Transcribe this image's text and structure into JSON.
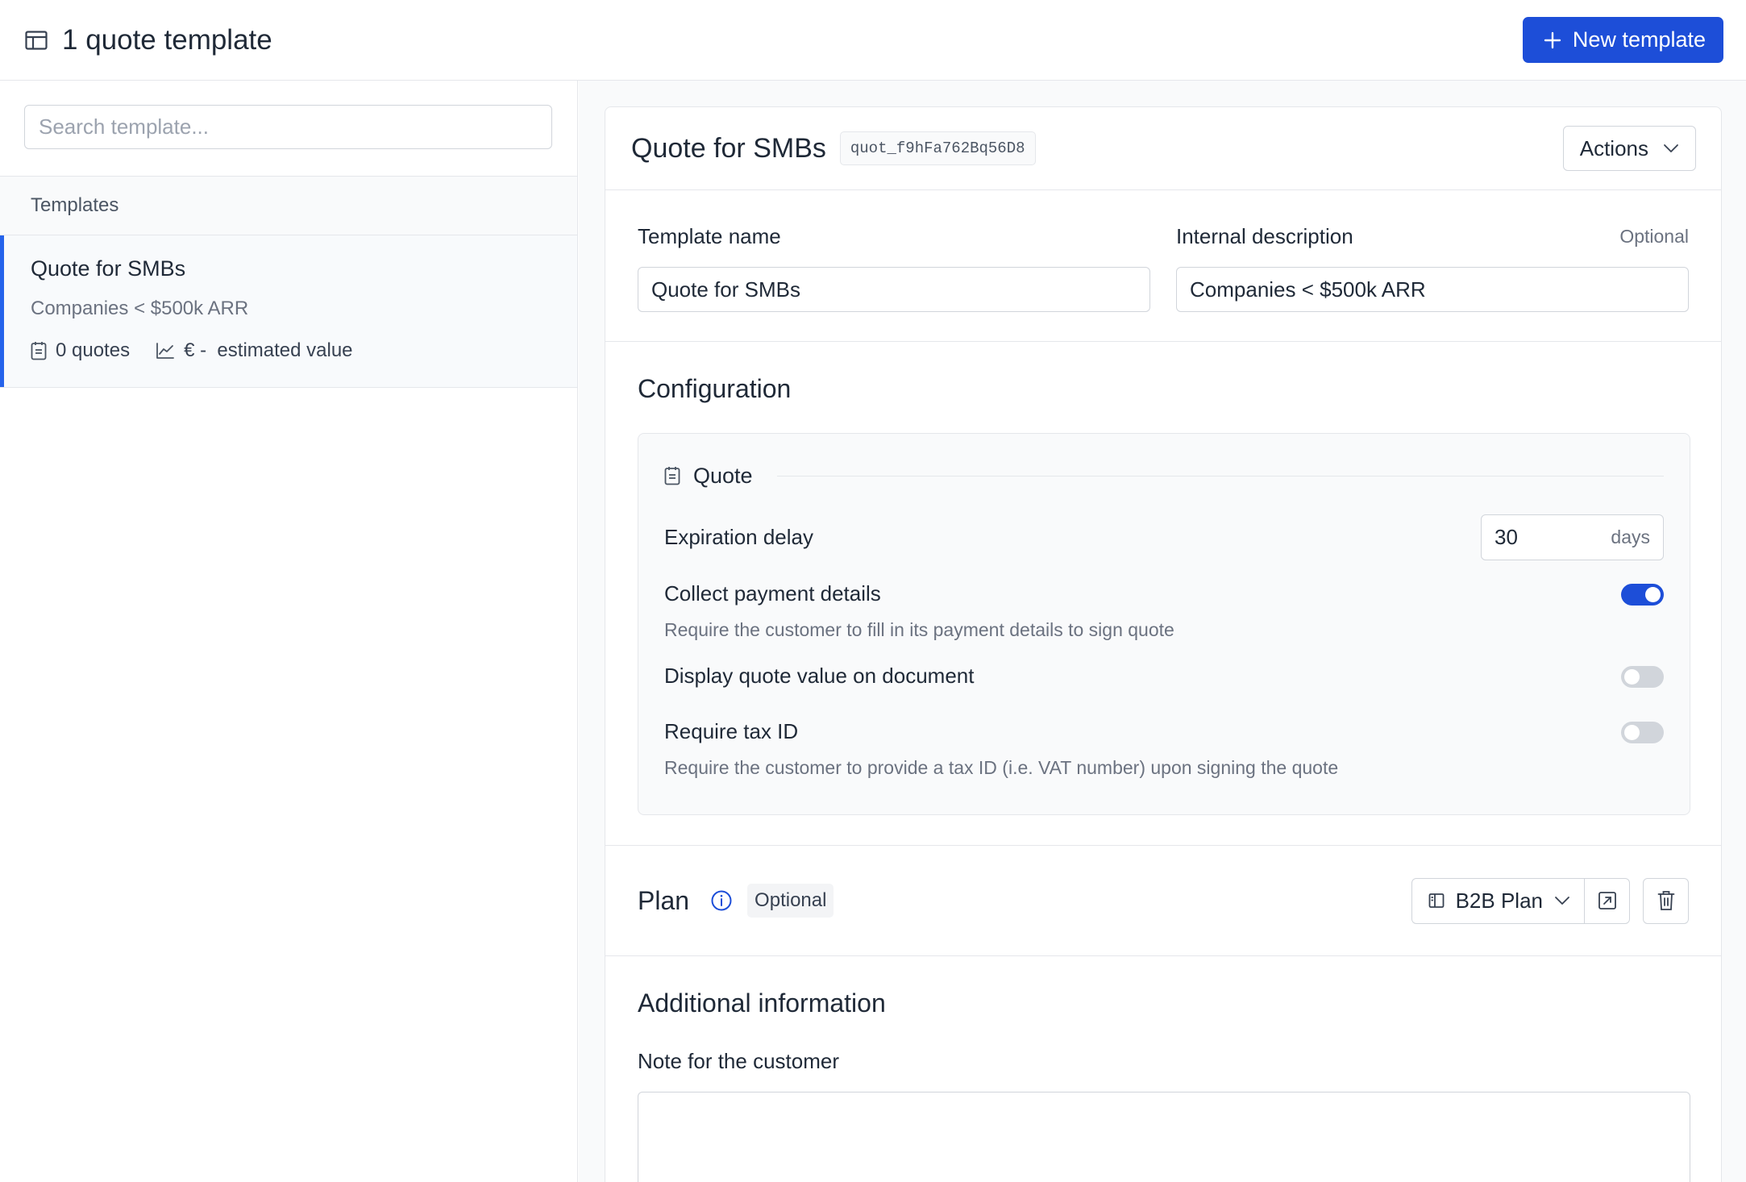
{
  "header": {
    "title": "1 quote template",
    "new_button_label": "New template"
  },
  "sidebar": {
    "search_placeholder": "Search template...",
    "section_label": "Templates",
    "templates": [
      {
        "name": "Quote for SMBs",
        "description": "Companies < $500k ARR",
        "quotes_count": "0 quotes",
        "estimated_value": "€ -  estimated value"
      }
    ]
  },
  "detail": {
    "title": "Quote for SMBs",
    "id": "quot_f9hFa762Bq56D8",
    "actions_label": "Actions",
    "fields": {
      "name_label": "Template name",
      "name_value": "Quote for SMBs",
      "description_label": "Internal description",
      "description_optional": "Optional",
      "description_value": "Companies < $500k ARR"
    },
    "configuration": {
      "title": "Configuration",
      "group_label": "Quote",
      "expiration_label": "Expiration delay",
      "expiration_value": "30",
      "expiration_unit": "days",
      "collect_payment_label": "Collect payment details",
      "collect_payment_help": "Require the customer to fill in its payment details to sign quote",
      "collect_payment_on": true,
      "display_value_label": "Display quote value on document",
      "display_value_on": false,
      "require_tax_label": "Require tax ID",
      "require_tax_help": "Require the customer to provide a tax ID (i.e. VAT number) upon signing the quote",
      "require_tax_on": false
    },
    "plan": {
      "title": "Plan",
      "optional_label": "Optional",
      "selected": "B2B Plan"
    },
    "additional": {
      "title": "Additional information",
      "note_label": "Note for the customer",
      "note_value": ""
    }
  },
  "colors": {
    "accent": "#1d4ed8",
    "selected_bar": "#2563eb"
  },
  "icons": {
    "header": "table-layout-icon",
    "quotes": "document-icon",
    "value": "trend-chart-icon",
    "plan_info": "info-icon",
    "plan_select": "book-icon",
    "open": "external-link-icon",
    "delete": "trash-icon"
  }
}
